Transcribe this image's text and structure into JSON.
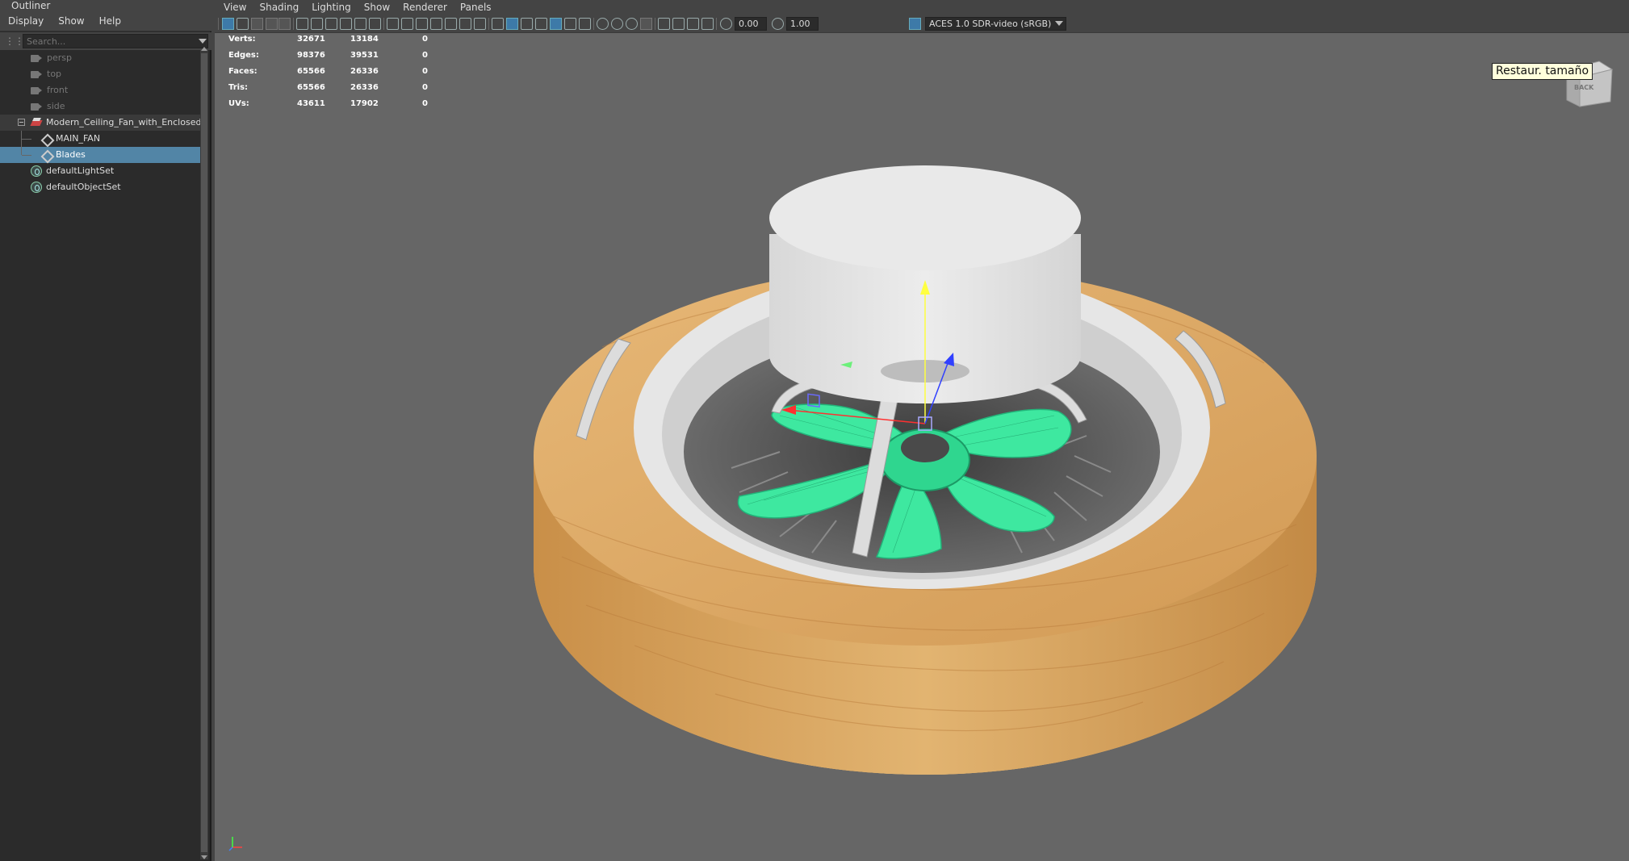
{
  "outliner": {
    "title": "Outliner",
    "menu": [
      "Display",
      "Show",
      "Help"
    ],
    "search_placeholder": "Search...",
    "items": [
      {
        "label": "persp"
      },
      {
        "label": "top"
      },
      {
        "label": "front"
      },
      {
        "label": "side"
      },
      {
        "label": "Modern_Ceiling_Fan_with_Enclosed_"
      },
      {
        "label": "MAIN_FAN"
      },
      {
        "label": "Blades"
      },
      {
        "label": "defaultLightSet"
      },
      {
        "label": "defaultObjectSet"
      }
    ]
  },
  "viewport": {
    "menu": [
      "View",
      "Shading",
      "Lighting",
      "Show",
      "Renderer",
      "Panels"
    ],
    "exposure": "0.00",
    "gamma": "1.00",
    "color_space": "ACES 1.0 SDR-video (sRGB)",
    "tooltip": "Restaur. tamaño",
    "viewcube_label": "BACK"
  },
  "hud": {
    "rows": [
      {
        "label": "Verts:",
        "total": "32671",
        "selected": "13184",
        "comp": "0"
      },
      {
        "label": "Edges:",
        "total": "98376",
        "selected": "39531",
        "comp": "0"
      },
      {
        "label": "Faces:",
        "total": "65566",
        "selected": "26336",
        "comp": "0"
      },
      {
        "label": "Tris:",
        "total": "65566",
        "selected": "26336",
        "comp": "0"
      },
      {
        "label": "UVs:",
        "total": "43611",
        "selected": "17902",
        "comp": "0"
      }
    ]
  },
  "colors": {
    "selection": "#5285a6",
    "wood": "#d9a45c",
    "blades": "#3ee8a0",
    "viewport_bg": "#666666"
  }
}
